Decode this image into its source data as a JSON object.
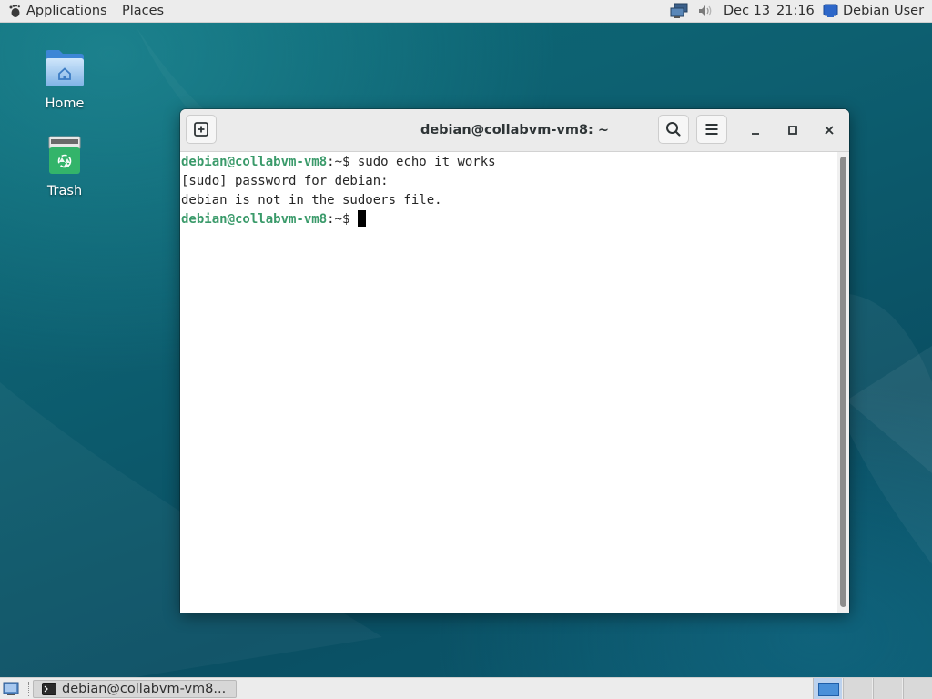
{
  "top_panel": {
    "applications_label": "Applications",
    "places_label": "Places",
    "date": "Dec 13",
    "time": "21:16",
    "user_label": "Debian User",
    "icons": [
      "gnome-foot-icon",
      "network-icon",
      "volume-icon",
      "user-icon"
    ]
  },
  "desktop": {
    "icons": [
      {
        "label": "Home",
        "icon": "home-folder-icon"
      },
      {
        "label": "Trash",
        "icon": "trash-icon"
      }
    ]
  },
  "terminal": {
    "title": "debian@collabvm-vm8: ~",
    "lines": [
      {
        "user": "debian@collabvm-vm8",
        "path": ":~$ ",
        "text": "sudo echo it works"
      },
      {
        "text": "[sudo] password for debian:"
      },
      {
        "text": "debian is not in the sudoers file."
      },
      {
        "user": "debian@collabvm-vm8",
        "path": ":~$ ",
        "text": ""
      }
    ],
    "buttons": [
      "new-tab-icon",
      "search-icon",
      "menu-icon",
      "minimize-icon",
      "maximize-icon",
      "close-icon"
    ]
  },
  "bottom_panel": {
    "task_label": "debian@collabvm-vm8...",
    "workspaces": 4,
    "active_workspace": 1
  },
  "colors": {
    "prompt_user": "#3a9a6a",
    "panel_bg": "#ececec",
    "desktop_bg": "#0d5f70"
  }
}
